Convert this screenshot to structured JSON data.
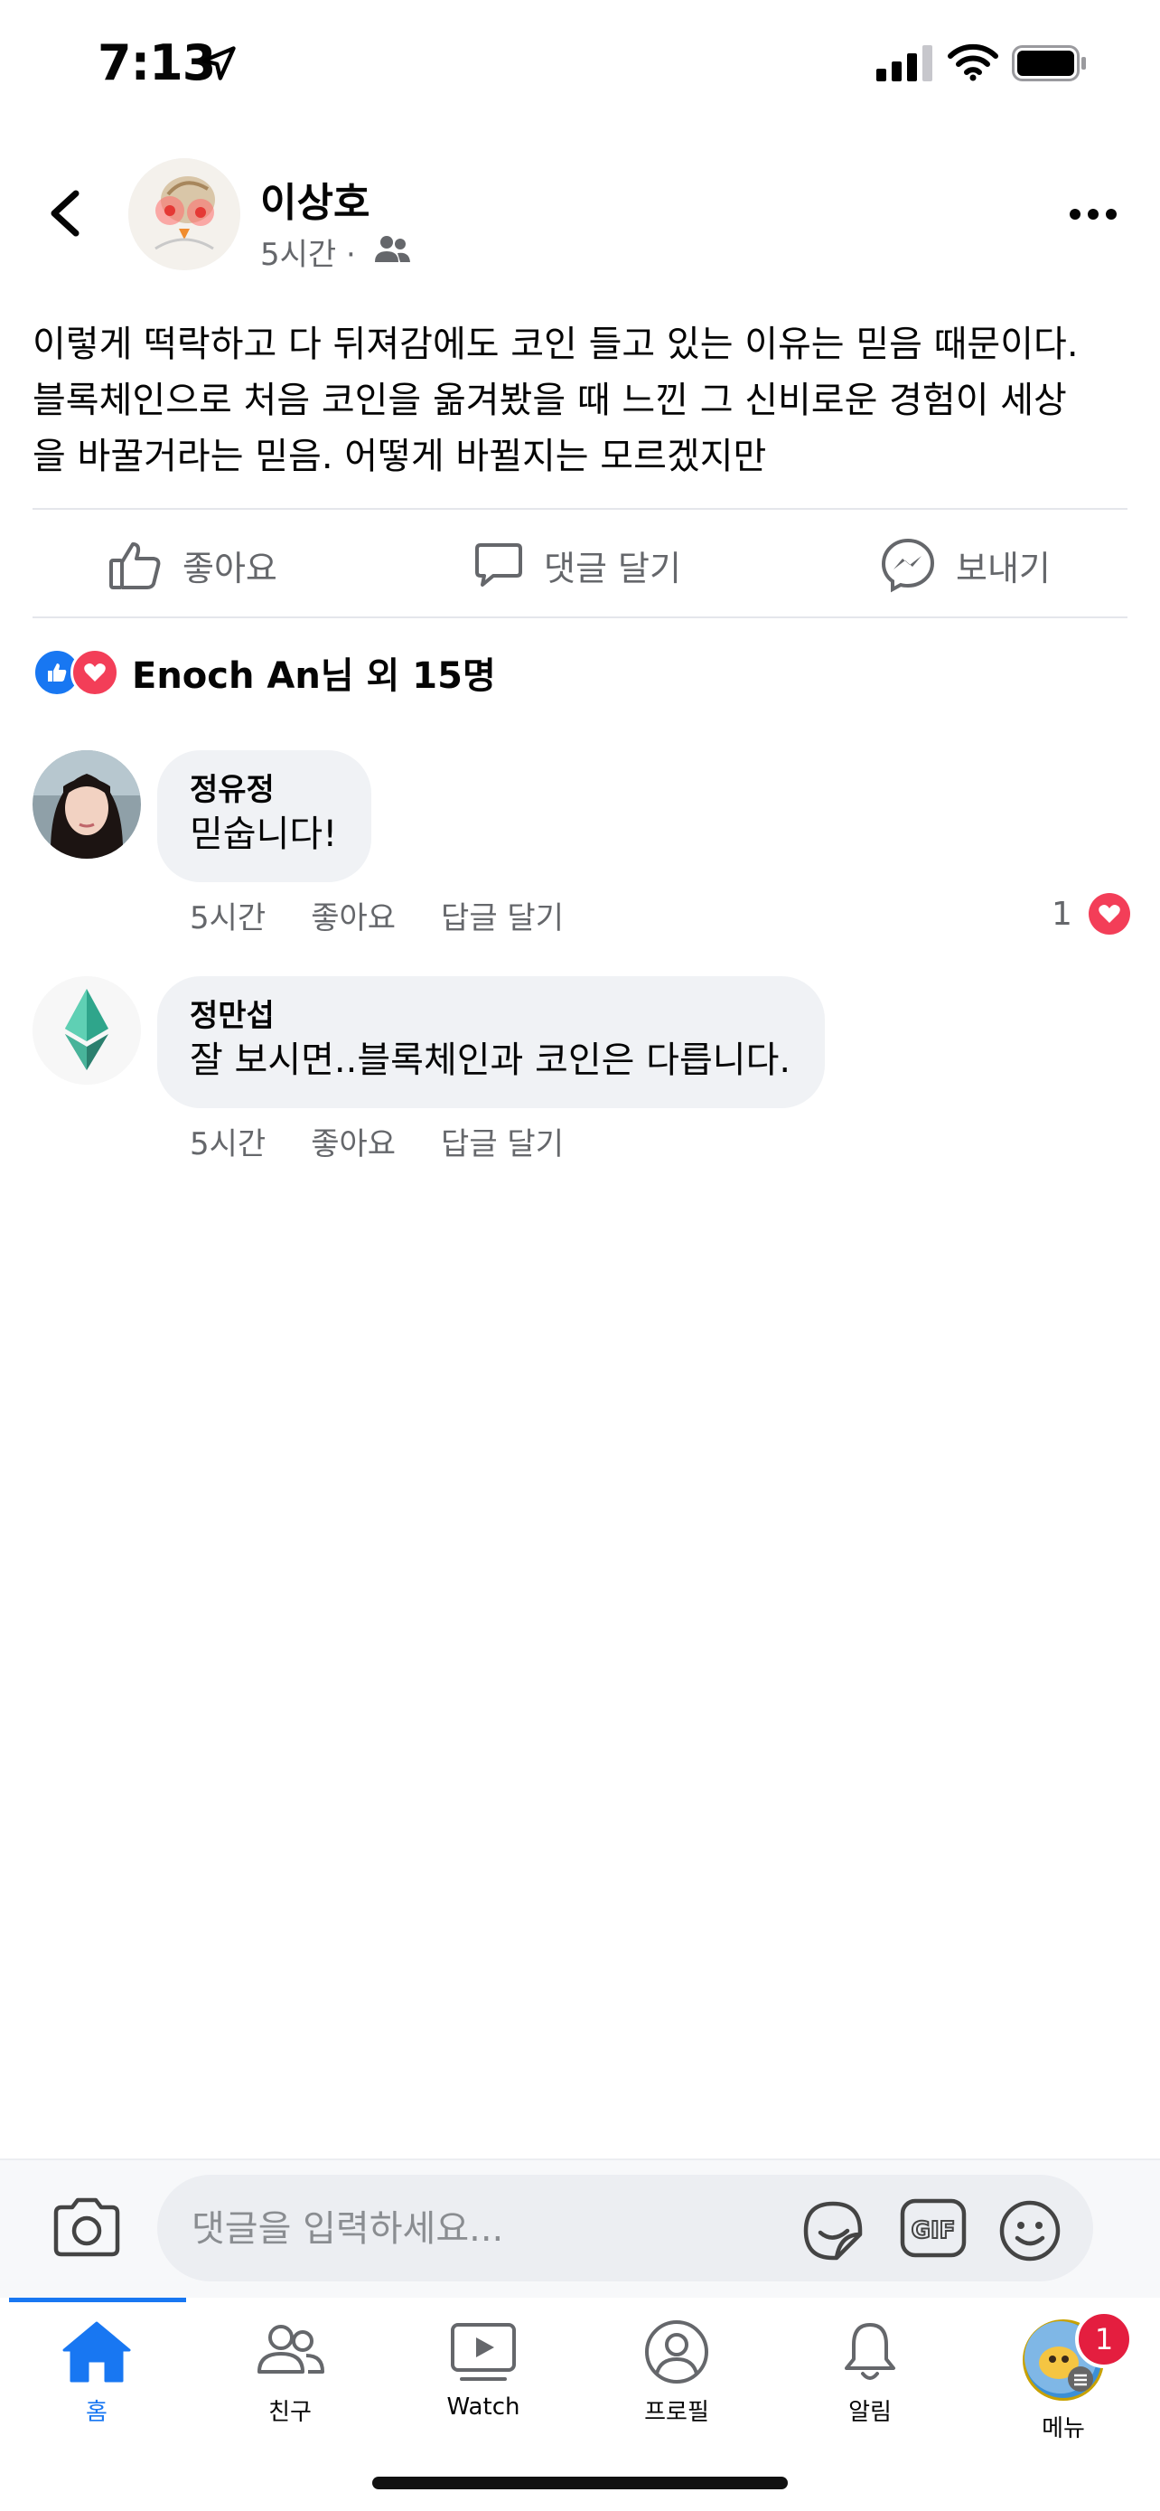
{
  "status_bar": {
    "time": "7:13"
  },
  "post": {
    "author": "이상호",
    "time": "5시간 ·",
    "text_lines": [
      "이렇게 떡락하고 다 뒤져감에도 코인 들고 있는 이유는 믿음 때문이다.",
      "블록체인으로 처음 코인을 옮겨봤을 때 느낀 그 신비로운 경험이 세상",
      "을 바꿀거라는 믿음. 어떻게 바뀔지는 모르겠지만"
    ],
    "actions": {
      "like": "좋아요",
      "comment": "댓글 달기",
      "send": "보내기"
    },
    "reactions_text": "Enoch An님 외 15명"
  },
  "comments": [
    {
      "name": "정유정",
      "text": "믿숩니다!",
      "time": "5시간",
      "like": "좋아요",
      "reply": "답글 달기",
      "reaction_count": "1"
    },
    {
      "name": "정만섭",
      "text": "잘 보시면..블록체인과 코인은 다릅니다.",
      "time": "5시간",
      "like": "좋아요",
      "reply": "답글 달기"
    }
  ],
  "composer": {
    "placeholder": "댓글을 입력하세요..."
  },
  "nav": {
    "items": [
      {
        "label": "홈",
        "icon": "home-icon"
      },
      {
        "label": "친구",
        "icon": "friends-icon"
      },
      {
        "label": "Watch",
        "icon": "watch-icon"
      },
      {
        "label": "프로필",
        "icon": "profile-icon"
      },
      {
        "label": "알림",
        "icon": "bell-icon"
      },
      {
        "label": "메뉴",
        "icon": "menu-avatar"
      }
    ],
    "notification_badge": "1"
  },
  "colors": {
    "accent": "#1877f2",
    "love": "#f33e58",
    "badge": "#e41e3f"
  }
}
